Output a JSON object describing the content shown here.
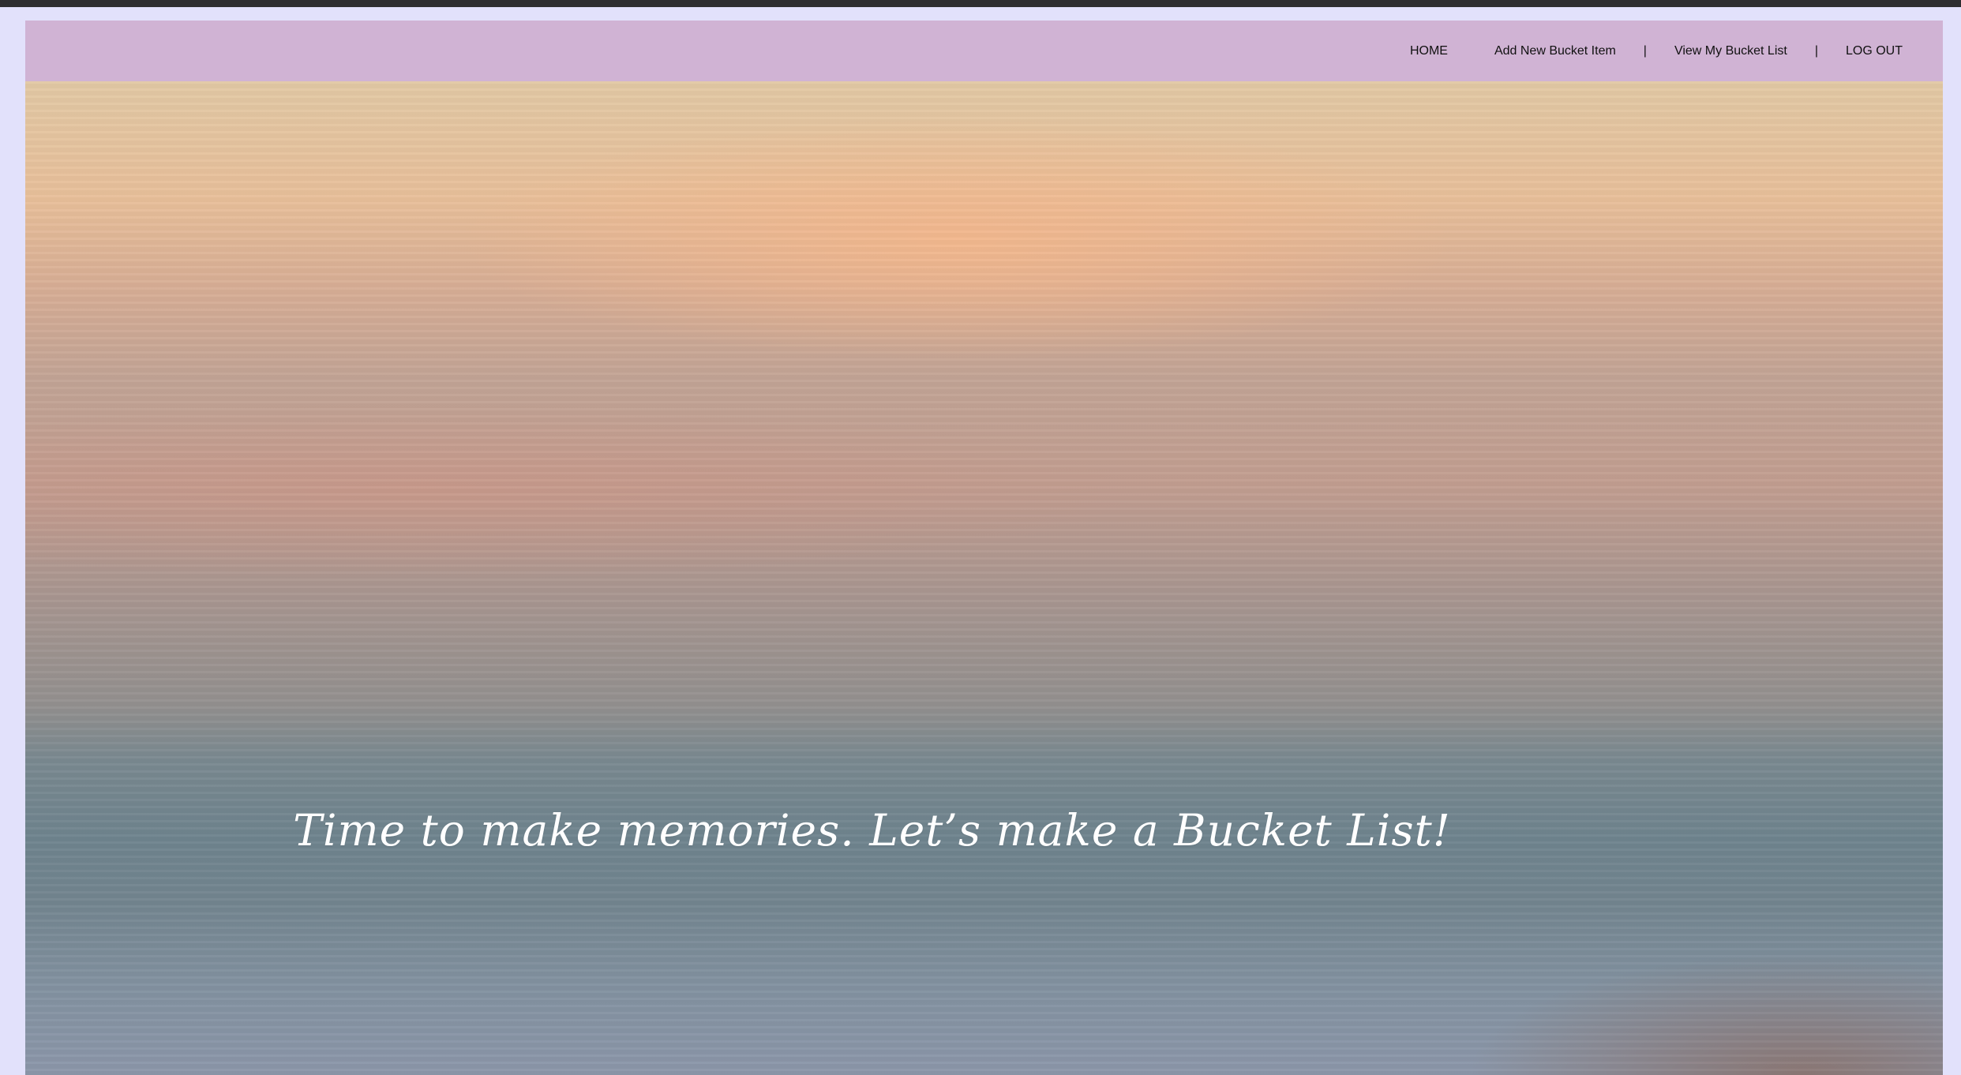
{
  "nav": {
    "items": [
      {
        "label": "HOME"
      },
      {
        "label": "Add New Bucket Item"
      },
      {
        "label": "View My Bucket List"
      },
      {
        "label": "LOG OUT"
      }
    ],
    "separator": "|"
  },
  "hero": {
    "tagline": "Time to make memories. Let’s make a Bucket List!"
  },
  "colors": {
    "navbar": "#d0b3d4",
    "page_background": "#e2e1fb",
    "tagline_text": "#ffffff"
  }
}
